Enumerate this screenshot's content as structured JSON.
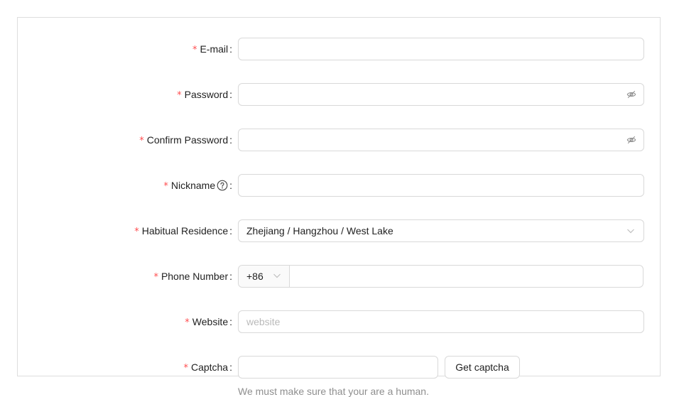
{
  "form": {
    "email": {
      "label": "E-mail",
      "value": ""
    },
    "password": {
      "label": "Password",
      "value": "",
      "suffix_icon": "eye-invisible-icon"
    },
    "confirm_password": {
      "label": "Confirm Password",
      "value": "",
      "suffix_icon": "eye-invisible-icon"
    },
    "nickname": {
      "label": "Nickname",
      "value": "",
      "help_icon": "question-circle-icon"
    },
    "residence": {
      "label": "Habitual Residence",
      "value": "Zhejiang / Hangzhou / West Lake",
      "icon": "chevron-down-icon"
    },
    "phone": {
      "label": "Phone Number",
      "prefix": "+86",
      "value": ""
    },
    "website": {
      "label": "Website",
      "value": "",
      "placeholder": "website"
    },
    "captcha": {
      "label": "Captcha",
      "value": "",
      "button_label": "Get captcha",
      "extra": "We must make sure that your are a human."
    },
    "required_mark": "*",
    "colon": ":"
  },
  "colors": {
    "required": "#ff4d4f",
    "border": "#d9d9d9",
    "icon": "#8c8c8c"
  }
}
